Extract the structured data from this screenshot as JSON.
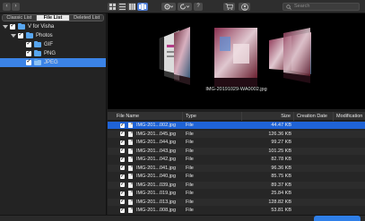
{
  "toolbar": {
    "nav_back": "‹",
    "nav_forward": "›",
    "help_label": "?",
    "search_placeholder": "Search"
  },
  "left_pane": {
    "tabs": [
      "Classic List",
      "File List",
      "Deleted List"
    ],
    "selected_tab": "File List",
    "tree": [
      {
        "label": "V for Visha"
      },
      {
        "label": "Photos"
      },
      {
        "label": "GIF"
      },
      {
        "label": "PNG"
      },
      {
        "label": "JPEG"
      }
    ]
  },
  "preview": {
    "caption": "IMG-20191029-WA0002.jpg"
  },
  "table": {
    "columns": [
      "File Name",
      "Type",
      "Size",
      "Creation Date",
      "Modification Date"
    ],
    "rows": [
      {
        "name": "IMG-201...002.jpg",
        "type": "File",
        "size": "44.47 KB",
        "creation": "",
        "modification": ""
      },
      {
        "name": "IMG-201...045.jpg",
        "type": "File",
        "size": "126.36 KB",
        "creation": "",
        "modification": ""
      },
      {
        "name": "IMG-201...044.jpg",
        "type": "File",
        "size": "99.27 KB",
        "creation": "",
        "modification": ""
      },
      {
        "name": "IMG-201...043.jpg",
        "type": "File",
        "size": "101.25 KB",
        "creation": "",
        "modification": ""
      },
      {
        "name": "IMG-201...042.jpg",
        "type": "File",
        "size": "82.78 KB",
        "creation": "",
        "modification": ""
      },
      {
        "name": "IMG-201...041.jpg",
        "type": "File",
        "size": "96.36 KB",
        "creation": "",
        "modification": ""
      },
      {
        "name": "IMG-201...040.jpg",
        "type": "File",
        "size": "85.75 KB",
        "creation": "",
        "modification": ""
      },
      {
        "name": "IMG-201...039.jpg",
        "type": "File",
        "size": "89.37 KB",
        "creation": "",
        "modification": ""
      },
      {
        "name": "IMG-201...019.jpg",
        "type": "File",
        "size": "25.84 KB",
        "creation": "",
        "modification": ""
      },
      {
        "name": "IMG-201...013.jpg",
        "type": "File",
        "size": "128.82 KB",
        "creation": "",
        "modification": ""
      },
      {
        "name": "IMG-201...008.jpg",
        "type": "File",
        "size": "53.81 KB",
        "creation": "",
        "modification": ""
      }
    ]
  },
  "colors": {
    "accent": "#3b83e6",
    "selected_row": "#1f63d6",
    "export_button": "#2f7fe8"
  }
}
